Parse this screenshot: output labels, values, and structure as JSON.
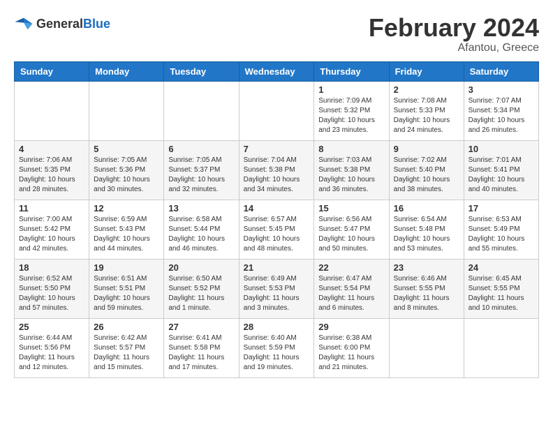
{
  "header": {
    "logo_general": "General",
    "logo_blue": "Blue",
    "main_title": "February 2024",
    "subtitle": "Afantou, Greece"
  },
  "weekdays": [
    "Sunday",
    "Monday",
    "Tuesday",
    "Wednesday",
    "Thursday",
    "Friday",
    "Saturday"
  ],
  "weeks": [
    [
      {
        "day": "",
        "info": ""
      },
      {
        "day": "",
        "info": ""
      },
      {
        "day": "",
        "info": ""
      },
      {
        "day": "",
        "info": ""
      },
      {
        "day": "1",
        "info": "Sunrise: 7:09 AM\nSunset: 5:32 PM\nDaylight: 10 hours\nand 23 minutes."
      },
      {
        "day": "2",
        "info": "Sunrise: 7:08 AM\nSunset: 5:33 PM\nDaylight: 10 hours\nand 24 minutes."
      },
      {
        "day": "3",
        "info": "Sunrise: 7:07 AM\nSunset: 5:34 PM\nDaylight: 10 hours\nand 26 minutes."
      }
    ],
    [
      {
        "day": "4",
        "info": "Sunrise: 7:06 AM\nSunset: 5:35 PM\nDaylight: 10 hours\nand 28 minutes."
      },
      {
        "day": "5",
        "info": "Sunrise: 7:05 AM\nSunset: 5:36 PM\nDaylight: 10 hours\nand 30 minutes."
      },
      {
        "day": "6",
        "info": "Sunrise: 7:05 AM\nSunset: 5:37 PM\nDaylight: 10 hours\nand 32 minutes."
      },
      {
        "day": "7",
        "info": "Sunrise: 7:04 AM\nSunset: 5:38 PM\nDaylight: 10 hours\nand 34 minutes."
      },
      {
        "day": "8",
        "info": "Sunrise: 7:03 AM\nSunset: 5:38 PM\nDaylight: 10 hours\nand 36 minutes."
      },
      {
        "day": "9",
        "info": "Sunrise: 7:02 AM\nSunset: 5:40 PM\nDaylight: 10 hours\nand 38 minutes."
      },
      {
        "day": "10",
        "info": "Sunrise: 7:01 AM\nSunset: 5:41 PM\nDaylight: 10 hours\nand 40 minutes."
      }
    ],
    [
      {
        "day": "11",
        "info": "Sunrise: 7:00 AM\nSunset: 5:42 PM\nDaylight: 10 hours\nand 42 minutes."
      },
      {
        "day": "12",
        "info": "Sunrise: 6:59 AM\nSunset: 5:43 PM\nDaylight: 10 hours\nand 44 minutes."
      },
      {
        "day": "13",
        "info": "Sunrise: 6:58 AM\nSunset: 5:44 PM\nDaylight: 10 hours\nand 46 minutes."
      },
      {
        "day": "14",
        "info": "Sunrise: 6:57 AM\nSunset: 5:45 PM\nDaylight: 10 hours\nand 48 minutes."
      },
      {
        "day": "15",
        "info": "Sunrise: 6:56 AM\nSunset: 5:47 PM\nDaylight: 10 hours\nand 50 minutes."
      },
      {
        "day": "16",
        "info": "Sunrise: 6:54 AM\nSunset: 5:48 PM\nDaylight: 10 hours\nand 53 minutes."
      },
      {
        "day": "17",
        "info": "Sunrise: 6:53 AM\nSunset: 5:49 PM\nDaylight: 10 hours\nand 55 minutes."
      }
    ],
    [
      {
        "day": "18",
        "info": "Sunrise: 6:52 AM\nSunset: 5:50 PM\nDaylight: 10 hours\nand 57 minutes."
      },
      {
        "day": "19",
        "info": "Sunrise: 6:51 AM\nSunset: 5:51 PM\nDaylight: 10 hours\nand 59 minutes."
      },
      {
        "day": "20",
        "info": "Sunrise: 6:50 AM\nSunset: 5:52 PM\nDaylight: 11 hours\nand 1 minute."
      },
      {
        "day": "21",
        "info": "Sunrise: 6:49 AM\nSunset: 5:53 PM\nDaylight: 11 hours\nand 3 minutes."
      },
      {
        "day": "22",
        "info": "Sunrise: 6:47 AM\nSunset: 5:54 PM\nDaylight: 11 hours\nand 6 minutes."
      },
      {
        "day": "23",
        "info": "Sunrise: 6:46 AM\nSunset: 5:55 PM\nDaylight: 11 hours\nand 8 minutes."
      },
      {
        "day": "24",
        "info": "Sunrise: 6:45 AM\nSunset: 5:55 PM\nDaylight: 11 hours\nand 10 minutes."
      }
    ],
    [
      {
        "day": "25",
        "info": "Sunrise: 6:44 AM\nSunset: 5:56 PM\nDaylight: 11 hours\nand 12 minutes."
      },
      {
        "day": "26",
        "info": "Sunrise: 6:42 AM\nSunset: 5:57 PM\nDaylight: 11 hours\nand 15 minutes."
      },
      {
        "day": "27",
        "info": "Sunrise: 6:41 AM\nSunset: 5:58 PM\nDaylight: 11 hours\nand 17 minutes."
      },
      {
        "day": "28",
        "info": "Sunrise: 6:40 AM\nSunset: 5:59 PM\nDaylight: 11 hours\nand 19 minutes."
      },
      {
        "day": "29",
        "info": "Sunrise: 6:38 AM\nSunset: 6:00 PM\nDaylight: 11 hours\nand 21 minutes."
      },
      {
        "day": "",
        "info": ""
      },
      {
        "day": "",
        "info": ""
      }
    ]
  ]
}
